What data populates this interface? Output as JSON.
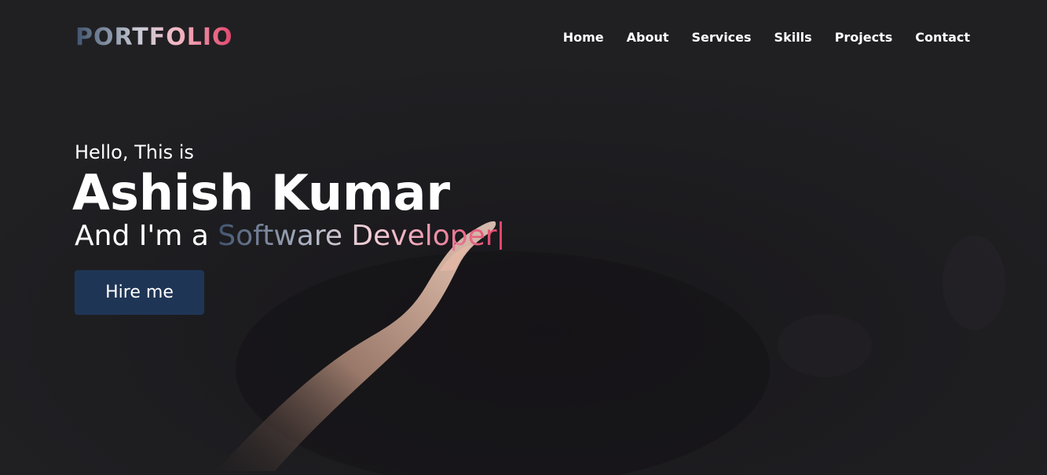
{
  "navbar": {
    "logo": "PORTFOLIO",
    "items": [
      {
        "label": "Home"
      },
      {
        "label": "About"
      },
      {
        "label": "Services"
      },
      {
        "label": "Skills"
      },
      {
        "label": "Projects"
      },
      {
        "label": "Contact"
      }
    ]
  },
  "hero": {
    "greeting": "Hello, This is",
    "name": "Ashish Kumar",
    "role_prefix": "And I'm a ",
    "role_typed": "Software Developer",
    "button_label": "Hire me"
  },
  "colors": {
    "background": "#202023",
    "button": "#1f3556",
    "accent_pink": "#e2466c",
    "accent_slate": "#3f536d"
  },
  "icons": {
    "typing_cursor": "text-cursor-icon"
  }
}
